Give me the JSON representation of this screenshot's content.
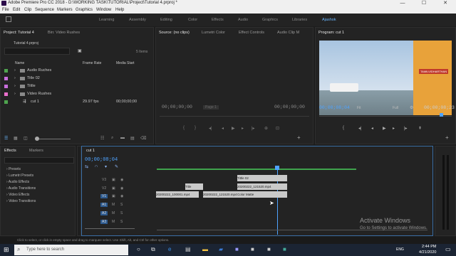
{
  "window": {
    "title": "Adobe Premiere Pro CC 2018 - D:\\WORKING TASK\\TUTORIAL\\Project\\Tutorial 4.prproj *",
    "min": "—",
    "max": "☐",
    "close": "✕"
  },
  "menu": [
    "File",
    "Edit",
    "Clip",
    "Sequence",
    "Markers",
    "Graphics",
    "Window",
    "Help"
  ],
  "workspaces": [
    "Learning",
    "Assembly",
    "Editing",
    "Color",
    "Effects",
    "Audio",
    "Graphics",
    "Libraries",
    "Ajashok"
  ],
  "project": {
    "tab_project": "Project: Tutorial 4",
    "tab_bin": "Bin: Video Rushes",
    "file": "Tutorial 4.prproj",
    "items_count": "5 Items",
    "col_name": "Name",
    "col_fps": "Frame Rate",
    "col_start": "Media Start",
    "rows": [
      {
        "name": "Audio Ruches",
        "color": "#4ea44e",
        "fps": "",
        "start": ""
      },
      {
        "name": "Title 02",
        "color": "#c86edc",
        "fps": "",
        "start": ""
      },
      {
        "name": "Tittle",
        "color": "#c86edc",
        "fps": "",
        "start": ""
      },
      {
        "name": "Video Rushes",
        "color": "#e96fcb",
        "fps": "",
        "start": ""
      },
      {
        "name": "cut 1",
        "color": "#4ea44e",
        "fps": "29.97 fps",
        "start": "00;00;00;00"
      }
    ]
  },
  "source": {
    "tab_source": "Source: (no clips)",
    "tab_lumetri": "Lumetri Color",
    "tab_effect_controls": "Effect Controls",
    "tab_audio": "Audio Clip M",
    "tc_left": "00;00;00;00",
    "page": "Page 1",
    "tc_right": "00;00;00;00"
  },
  "program": {
    "tab": "Program: cut 1",
    "overlay_text": "TAMILVIDHARTHAN",
    "tc_left": "00;00;08;04",
    "fit": "Fit",
    "quality": "Full",
    "tc_right": "00;00;08;23"
  },
  "effects": {
    "tab_effects": "Effects",
    "tab_markers": "Markers",
    "items": [
      "Presets",
      "Lumetri Presets",
      "Audio Effects",
      "Audio Transitions",
      "Video Effects",
      "Video Transitions"
    ]
  },
  "timeline": {
    "tab": "cut 1",
    "timecode": "00;00;08;04",
    "tracks": [
      "V3",
      "V2",
      "V1",
      "A1",
      "A2",
      "A3"
    ],
    "clips": [
      {
        "label": "Tittle 02",
        "color": "#c9c9c9"
      },
      {
        "label": "20200222_121520.mp4",
        "color": "#c9c9c9"
      },
      {
        "label": "Title",
        "color": "#c9c9c9"
      },
      {
        "label": "20200222_100001.mp4",
        "color": "#c9c9c9"
      },
      {
        "label": "20200222_121520.mp4",
        "color": "#c9c9c9"
      },
      {
        "label": "Color Matte",
        "color": "#c9c9c9"
      }
    ]
  },
  "status": "Click to select, or click in empty space and drag to marquee select. Use Shift, Alt, and Ctrl for other options.",
  "watermark": {
    "title": "Activate Windows",
    "sub": "Go to Settings to activate Windows."
  },
  "taskbar": {
    "search": "Type here to search",
    "time": "2:44 PM",
    "date": "4/21/2020",
    "lang": "ENG"
  }
}
